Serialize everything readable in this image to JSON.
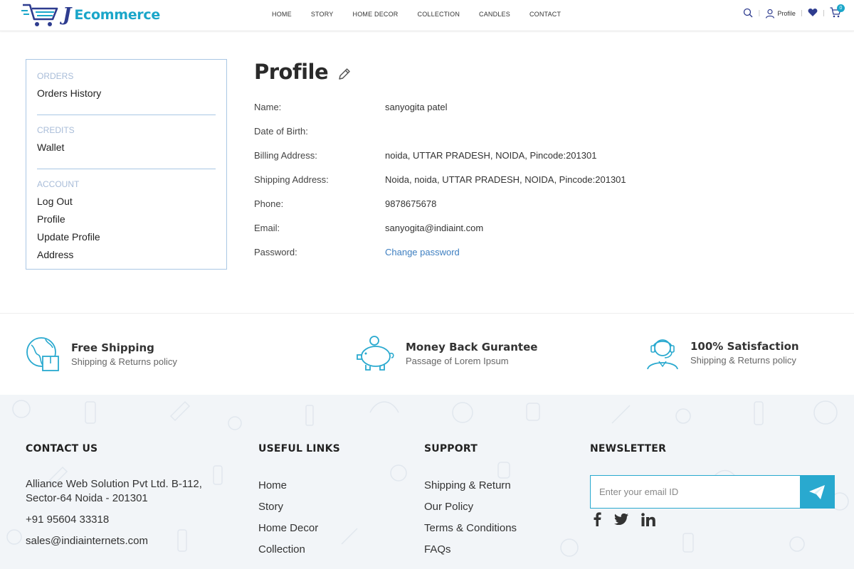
{
  "header": {
    "logo_text": "Ecommerce",
    "logo_letter": "J",
    "nav": [
      "HOME",
      "STORY",
      "HOME DECOR",
      "COLLECTION",
      "CANDLES",
      "CONTACT"
    ],
    "profile_label": "Profile",
    "cart_count": "0"
  },
  "sidebar": {
    "groups": [
      {
        "heading": "ORDERS",
        "items": [
          "Orders History"
        ]
      },
      {
        "heading": "CREDITS",
        "items": [
          "Wallet"
        ]
      },
      {
        "heading": "ACCOUNT",
        "items": [
          "Log Out",
          "Profile",
          "Update Profile",
          "Address"
        ]
      }
    ]
  },
  "profile": {
    "title": "Profile",
    "rows": [
      {
        "label": "Name:",
        "value": "sanyogita patel"
      },
      {
        "label": "Date of Birth:",
        "value": ""
      },
      {
        "label": "Billing Address:",
        "value": "noida, UTTAR PRADESH, NOIDA, Pincode:201301"
      },
      {
        "label": "Shipping Address:",
        "value": "Noida, noida, UTTAR PRADESH, NOIDA, Pincode:201301"
      },
      {
        "label": "Phone:",
        "value": "9878675678"
      },
      {
        "label": "Email:",
        "value": "sanyogita@indiaint.com"
      },
      {
        "label": "Password:",
        "value": "Change password"
      }
    ]
  },
  "features": [
    {
      "title": "Free Shipping",
      "subtitle": "Shipping & Returns policy",
      "icon": "globe-package-icon"
    },
    {
      "title": "Money Back Gurantee",
      "subtitle": "Passage of Lorem Ipsum",
      "icon": "piggy-bank-icon"
    },
    {
      "title": "100% Satisfaction",
      "subtitle": "Shipping & Returns policy",
      "icon": "support-agent-icon"
    }
  ],
  "footer": {
    "contact": {
      "heading": "CONTACT US",
      "address_line1": "Alliance Web Solution Pvt Ltd. B-112,",
      "address_line2": "Sector-64 Noida - 201301",
      "phone": "+91 95604 33318",
      "email": "sales@indiainternets.com"
    },
    "useful_links": {
      "heading": "USEFUL LINKS",
      "links": [
        "Home",
        "Story",
        "Home Decor",
        "Collection"
      ]
    },
    "support": {
      "heading": "SUPPORT",
      "links": [
        "Shipping & Return",
        "Our Policy",
        "Terms & Conditions",
        "FAQs"
      ]
    },
    "newsletter": {
      "heading": "NEWSLETTER",
      "placeholder": "Enter your email ID"
    }
  },
  "colors": {
    "accent": "#29a9cf",
    "brand_dark": "#2e3c8f",
    "sidebar_border": "#a9c7e4",
    "link": "#3e7fc1",
    "footer_bg": "#f2f5f8"
  }
}
